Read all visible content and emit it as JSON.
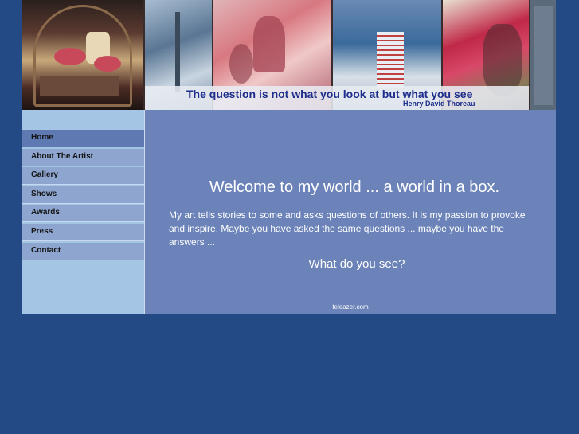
{
  "banner": {
    "quote": "The question is not what you look at but what you see",
    "author": "Henry David Thoreau"
  },
  "nav": {
    "items": [
      {
        "label": "Home",
        "active": true
      },
      {
        "label": "About The Artist",
        "active": false
      },
      {
        "label": "Gallery",
        "active": false
      },
      {
        "label": "Shows",
        "active": false
      },
      {
        "label": "Awards",
        "active": false
      },
      {
        "label": "Press",
        "active": false
      },
      {
        "label": "Contact",
        "active": false
      }
    ]
  },
  "main": {
    "headline": "Welcome to my world ... a world in a box.",
    "intro": "My art tells stories to some and asks questions of others.  It is my passion to provoke and inspire.  Maybe you have asked the same questions ... maybe you have the answers ...",
    "question": "What do you see?",
    "footer_link": "teleazer.com"
  },
  "colors": {
    "page_background": "#234a84",
    "sidebar_background": "#a4c6e4",
    "nav_item": "#8da5cf",
    "nav_item_active": "#5f7ab2",
    "main_background": "#6b83b8",
    "quote_text": "#1c2d8c"
  }
}
